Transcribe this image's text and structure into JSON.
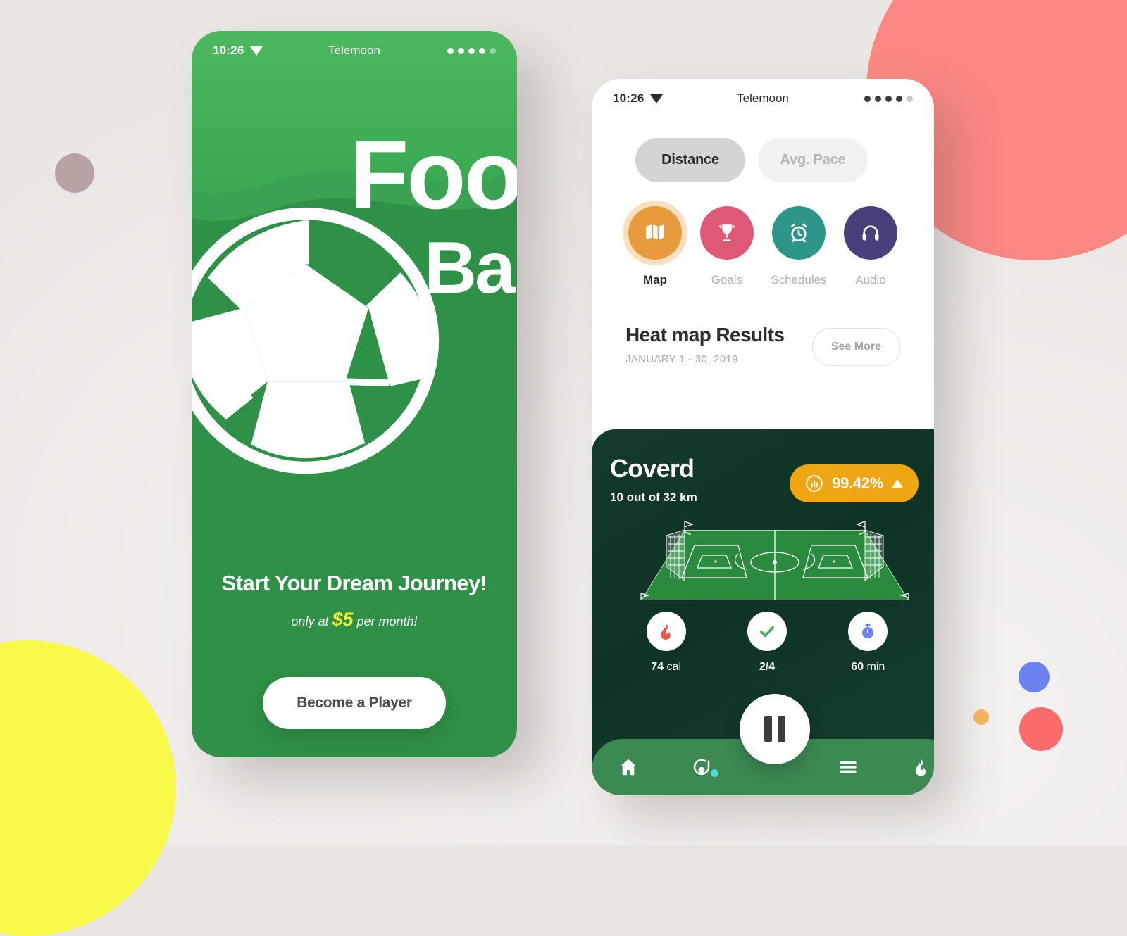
{
  "background": {
    "base_color": "#eae6e4",
    "shapes": [
      {
        "name": "coral-circle",
        "color": "#fb8883"
      },
      {
        "name": "yellow-circle",
        "color": "#f9f94a"
      },
      {
        "name": "mauve-dot",
        "color": "#b8a3a3"
      },
      {
        "name": "blue-dot",
        "color": "#6b82f0"
      },
      {
        "name": "orange-dot",
        "color": "#fcb661"
      },
      {
        "name": "red-dot",
        "color": "#fc6b6b"
      }
    ]
  },
  "onboarding_screen": {
    "status_bar": {
      "time": "10:26",
      "carrier": "Telemoon",
      "signal_icon": "wifi-icon",
      "dots": 5
    },
    "hero": {
      "title_line1": "Foot",
      "title_line2": "Ball",
      "ball_icon": "soccer-ball-icon",
      "player_icon": "player-silhouette-icon",
      "accent_color": "#2f9047"
    },
    "tagline": "Start Your Dream Journey!",
    "price_prefix": "only at ",
    "price": "$5",
    "price_suffix": " per month!",
    "price_color": "#f6f134",
    "cta_label": "Become a Player"
  },
  "tracker_screen": {
    "status_bar": {
      "time": "10:26",
      "carrier": "Telemoon",
      "signal_icon": "wifi-icon",
      "dots": 5
    },
    "segments": [
      {
        "label": "Distance",
        "active": true
      },
      {
        "label": "Avg. Pace",
        "active": false
      }
    ],
    "categories": [
      {
        "label": "Map",
        "icon": "map-icon",
        "color": "#e89b3c",
        "selected": true
      },
      {
        "label": "Goals",
        "icon": "trophy-icon",
        "color": "#e05878",
        "selected": false
      },
      {
        "label": "Schedules",
        "icon": "alarm-clock-icon",
        "color": "#2e9589",
        "selected": false
      },
      {
        "label": "Audio",
        "icon": "headphones-icon",
        "color": "#4a3f7a",
        "selected": false
      }
    ],
    "results": {
      "title": "Heat map Results",
      "date_range": "JANUARY 1 - 30, 2019",
      "see_more_label": "See More"
    },
    "coverage_card": {
      "title": "Coverd",
      "subtitle": "10 out of 32 km",
      "badge_icon": "bar-chart-icon",
      "badge_value": "99.42%",
      "badge_trend": "up",
      "badge_color": "#efa613",
      "pitch_icon": "football-pitch-icon",
      "stats": [
        {
          "icon": "flame-icon",
          "icon_color": "#f0524e",
          "value": "74",
          "unit": " cal"
        },
        {
          "icon": "check-icon",
          "icon_color": "#4caf63",
          "value": "2/4",
          "unit": ""
        },
        {
          "icon": "stopwatch-icon",
          "icon_color": "#6b82f0",
          "value": "60",
          "unit": " min"
        }
      ]
    },
    "fab": {
      "icon": "pause-icon"
    },
    "nav_items": [
      {
        "icon": "home-icon",
        "badge": false
      },
      {
        "icon": "profile-icon",
        "badge": true
      },
      {
        "icon": "menu-icon",
        "badge": false
      },
      {
        "icon": "flame-icon",
        "badge": false
      }
    ]
  }
}
